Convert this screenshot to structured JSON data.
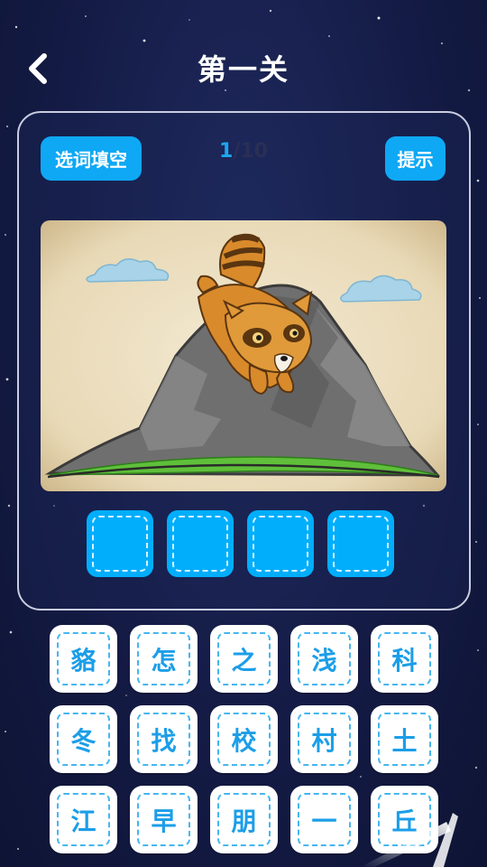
{
  "header": {
    "title": "第一关",
    "back_icon": "chevron-left-icon"
  },
  "toolbar": {
    "mode_label": "选词填空",
    "hint_label": "提示",
    "progress_current": "1",
    "progress_total": "/10"
  },
  "puzzle": {
    "image_icon": "raccoon-on-mountain-illustration",
    "answer_slots": [
      "",
      "",
      "",
      ""
    ]
  },
  "word_bank": [
    "貉",
    "怎",
    "之",
    "浅",
    "科",
    "冬",
    "找",
    "校",
    "村",
    "土",
    "江",
    "早",
    "朋",
    "一",
    "丘"
  ],
  "colors": {
    "accent": "#0ea8f5",
    "slot": "#00aefc",
    "tile_text": "#1c9ee8",
    "background": "#141b45"
  }
}
